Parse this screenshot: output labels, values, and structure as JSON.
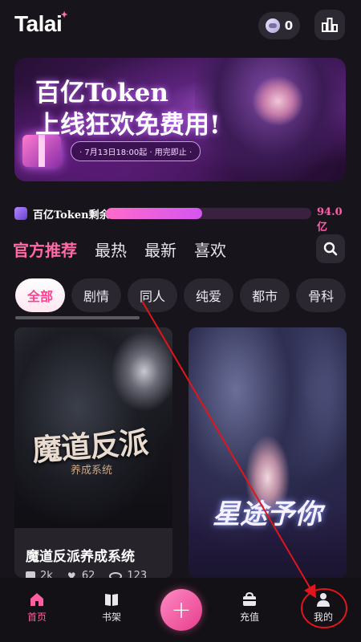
{
  "app": {
    "logo": "Talai",
    "logo_spark": "✦",
    "coin_count": "0"
  },
  "banner": {
    "title_line1": "百亿Token",
    "title_line2": "上线狂欢免费用!",
    "date_text": "· 7月13日18:00起 · 用完即止 ·"
  },
  "token": {
    "label": "百亿Token剩余",
    "remaining": "94.0亿",
    "fill_fraction": 0.47
  },
  "tabs": [
    {
      "label": "官方推荐",
      "active": true
    },
    {
      "label": "最热",
      "active": false
    },
    {
      "label": "最新",
      "active": false
    },
    {
      "label": "喜欢",
      "active": false
    }
  ],
  "chips": [
    {
      "label": "全部",
      "active": true
    },
    {
      "label": "剧情",
      "active": false
    },
    {
      "label": "同人",
      "active": false
    },
    {
      "label": "纯爱",
      "active": false
    },
    {
      "label": "都市",
      "active": false
    },
    {
      "label": "骨科",
      "active": false
    }
  ],
  "cards": [
    {
      "cover_title": "魔道反派",
      "cover_subtitle": "养成系统",
      "title": "魔道反派养成系统",
      "stats": {
        "a": "2k",
        "b": "62",
        "c": "123"
      }
    },
    {
      "cover_title": "星途予你"
    }
  ],
  "bottom_nav": {
    "home": "首页",
    "bookshelf": "书架",
    "create": "+",
    "recharge": "充值",
    "mine": "我的"
  },
  "colors": {
    "accent": "#ff5fa0",
    "annotation": "#e0161c"
  },
  "icons": [
    "coin-icon",
    "ranking-icon",
    "search-icon",
    "home-icon",
    "book-icon",
    "plus-icon",
    "bag-icon",
    "user-icon"
  ]
}
